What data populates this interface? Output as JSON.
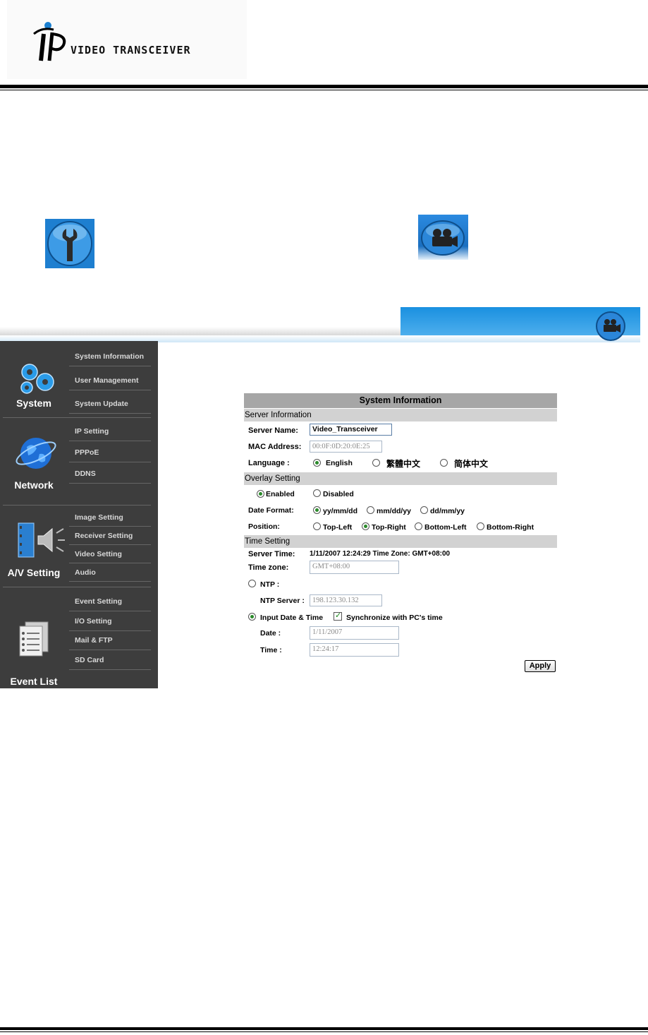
{
  "doc": {
    "logo_text": "VIDEO TRANSCEIVER"
  },
  "icons": {
    "wrench": "wrench-icon",
    "camera": "movie-camera-icon",
    "gears": "gears-icon",
    "globe": "globe-icon",
    "av": "film-speaker-icon",
    "event": "event-list-icon"
  },
  "colors": {
    "sidebar_bg": "#3d3d3d",
    "panel_title_bg": "#a6a6a6",
    "section_bg": "#d2d2d2",
    "accent_blue": "#1a90e0"
  },
  "sidebar": {
    "system": {
      "title": "System",
      "items": [
        "System Information",
        "User Management",
        "System Update"
      ]
    },
    "network": {
      "title": "Network",
      "items": [
        "IP Setting",
        "PPPoE",
        "DDNS"
      ]
    },
    "av": {
      "title": "A/V Setting",
      "items": [
        "Image Setting",
        "Receiver Setting",
        "Video Setting",
        "Audio"
      ]
    },
    "event": {
      "title": "Event List",
      "items": [
        "Event Setting",
        "I/O Setting",
        "Mail & FTP",
        "SD Card"
      ]
    }
  },
  "panel": {
    "title": "System Information",
    "server": {
      "section": "Server Information",
      "name_label": "Server Name:",
      "name_value": "Video_Transceiver",
      "mac_label": "MAC Address:",
      "mac_value": "00:0F:0D:20:0E:25",
      "language_label": "Language :",
      "languages": [
        "English",
        "繁體中文",
        "简体中文"
      ],
      "language_selected": "English"
    },
    "overlay": {
      "section": "Overlay Setting",
      "enabled": "Enabled",
      "disabled": "Disabled",
      "date_format_label": "Date Format:",
      "date_formats": [
        "yy/mm/dd",
        "mm/dd/yy",
        "dd/mm/yy"
      ],
      "position_label": "Position:",
      "positions": [
        "Top-Left",
        "Top-Right",
        "Bottom-Left",
        "Bottom-Right"
      ]
    },
    "time": {
      "section": "Time Setting",
      "server_time_label": "Server Time:",
      "server_time_value": "1/11/2007 12:24:29 Time Zone: GMT+08:00",
      "timezone_label": "Time zone:",
      "timezone_value": "GMT+08:00",
      "ntp_label": "NTP :",
      "ntp_server_label": "NTP Server :",
      "ntp_server_value": "198.123.30.132",
      "input_label": "Input Date & Time",
      "sync_label": "Synchronize with PC's time",
      "date_label": "Date :",
      "date_value": "1/11/2007",
      "time_label": "Time :",
      "time_value": "12:24:17"
    },
    "apply": "Apply"
  }
}
